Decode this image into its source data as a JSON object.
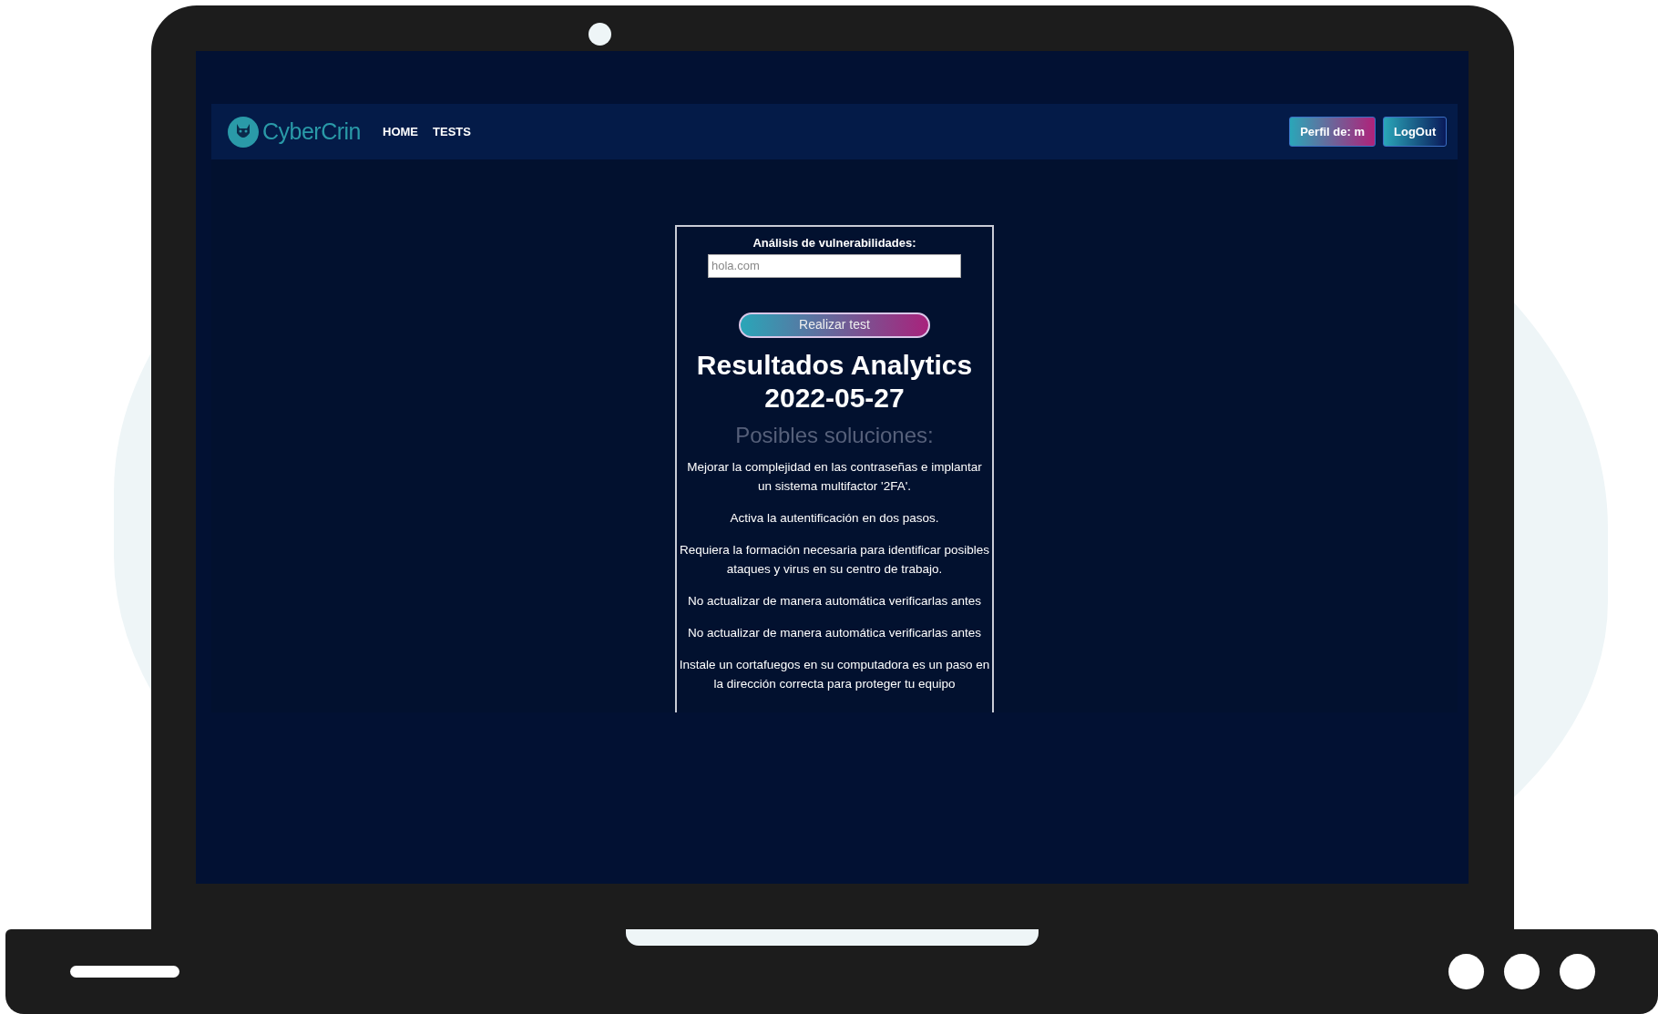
{
  "navbar": {
    "brand": "CyberCrin",
    "links": [
      {
        "label": "HOME"
      },
      {
        "label": "TESTS"
      }
    ],
    "buttons": [
      {
        "label": "Perfil de: m",
        "kind": "profile"
      },
      {
        "label": "LogOut",
        "kind": "logout"
      }
    ]
  },
  "form": {
    "label": "Análisis de vulnerabilidades:",
    "placeholder": "hola.com",
    "button": "Realizar test"
  },
  "results": {
    "title": "Resultados Analytics 2022-05-27",
    "subtitle": "Posibles soluciones:",
    "solutions": [
      "Mejorar la complejidad en las contraseñas e implantar un sistema multifactor '2FA'.",
      "Activa la autentificación en dos pasos.",
      "Requiera la formación necesaria para identificar posibles ataques y virus en su centro de trabajo.",
      "No actualizar de manera automática verificarlas antes",
      "No actualizar de manera automática verificarlas antes",
      "Instale un cortafuegos en su computadora es un paso en la dirección correcta para proteger tu equipo"
    ]
  }
}
